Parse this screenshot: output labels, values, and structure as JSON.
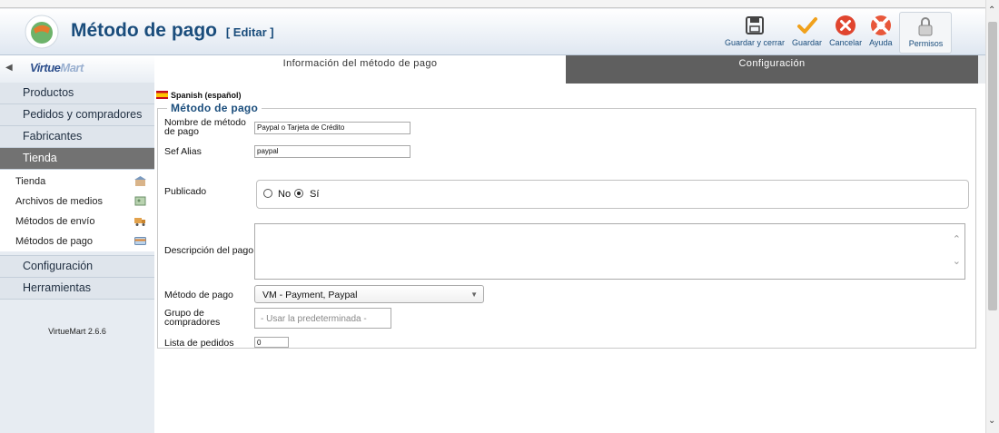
{
  "header": {
    "title": "Método de pago",
    "edit_label": "[ Editar ]"
  },
  "toolbar": {
    "save_close": "Guardar y cerrar",
    "save": "Guardar",
    "cancel": "Cancelar",
    "help": "Ayuda",
    "permissions": "Permisos"
  },
  "sidebar": {
    "logo_main": "Virtue",
    "logo_accent": "Mart",
    "items": [
      {
        "label": "Productos"
      },
      {
        "label": "Pedidos y compradores"
      },
      {
        "label": "Fabricantes"
      },
      {
        "label": "Tienda"
      }
    ],
    "subitems": [
      {
        "label": "Tienda"
      },
      {
        "label": "Archivos de medios"
      },
      {
        "label": "Métodos de envío"
      },
      {
        "label": "Métodos de pago"
      }
    ],
    "items_after": [
      {
        "label": "Configuración"
      },
      {
        "label": "Herramientas"
      }
    ],
    "version": "VirtueMart 2.6.6"
  },
  "tabs": [
    {
      "label": "Información del método de pago"
    },
    {
      "label": "Configuración"
    }
  ],
  "form": {
    "language": "Spanish (español)",
    "legend": "Método de pago",
    "name_label": "Nombre de método de pago",
    "name_value": "Paypal o Tarjeta de Crédito",
    "alias_label": "Sef Alias",
    "alias_value": "paypal",
    "published_label": "Publicado",
    "published_no": "No",
    "published_yes": "Sí",
    "description_label": "Descripción del pago",
    "method_label": "Método de pago",
    "method_value": "VM - Payment, Paypal",
    "group_label": "Grupo de compradores",
    "group_placeholder": "- Usar la predeterminada -",
    "order_label": "Lista de pedidos",
    "order_value": "0"
  }
}
